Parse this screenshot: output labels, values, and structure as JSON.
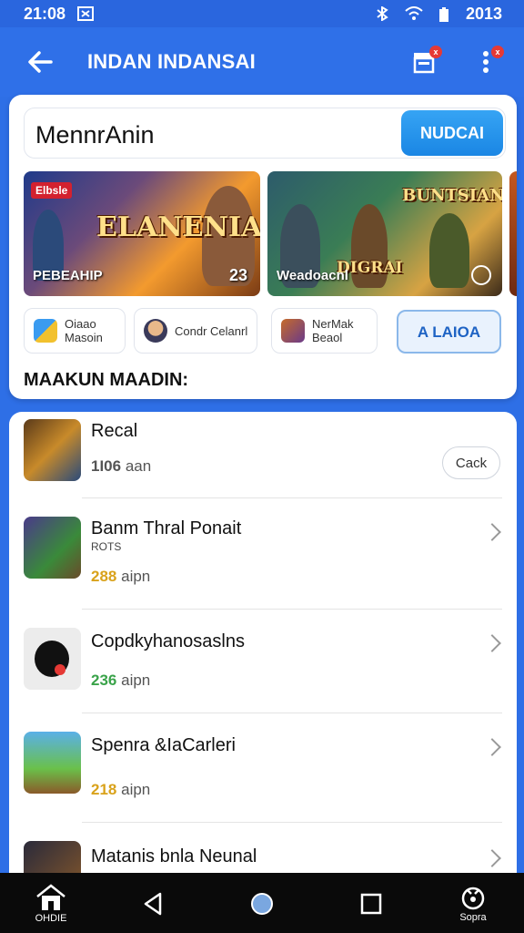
{
  "status_bar": {
    "time": "21:08",
    "right_text": "2013",
    "icons": [
      "notification-icon",
      "bluetooth-icon",
      "wifi-icon",
      "battery-icon"
    ]
  },
  "app_bar": {
    "title": "INDAN INDANSAI",
    "back_icon": "arrow-left-icon",
    "actions": [
      {
        "icon": "store-icon",
        "badge": "x"
      },
      {
        "icon": "more-vert-icon",
        "badge": "x"
      }
    ]
  },
  "search": {
    "value": "MennrAnin",
    "button_label": "NUDCAI"
  },
  "banners": [
    {
      "tag": "Elbsle",
      "logo": "ELANENIAI",
      "caption": "PEBEAHIP",
      "number": "23"
    },
    {
      "logo": "BUNTSIAN",
      "caption": "Weadoacnl",
      "logo2": "DIGRAI"
    }
  ],
  "chips": [
    {
      "label": "Oiaao\nMasoin",
      "icon_color": "#3a9bf0"
    },
    {
      "label": "Condr Celanrl",
      "icon_color": "#8a6b5a"
    },
    {
      "label": "NerMak\nBeaol",
      "icon_color": "#c66b2a"
    },
    {
      "label": "A LAIOA",
      "icon_color": ""
    }
  ],
  "section_title": "MAAKUN MAADIN:",
  "list_items": [
    {
      "title": "Recal",
      "meta_num": "1I06",
      "meta_unit": "aan",
      "action": "Cack",
      "meta_color": "#555555"
    },
    {
      "title": "Banm Thral Ponait",
      "sub": "ROTS",
      "meta_num": "288",
      "meta_unit": "aipn",
      "meta_color": "#d9a21b"
    },
    {
      "title": "Copdkyhanosaslns",
      "meta_num": "236",
      "meta_unit": "aipn",
      "meta_color": "#3aa34a"
    },
    {
      "title": "Spenra &IaCarleri",
      "meta_num": "218",
      "meta_unit": "aipn",
      "meta_color": "#d9a21b"
    },
    {
      "title": "Matanis bnla Neunal"
    }
  ],
  "nav": {
    "home_label": "OHDIE",
    "right_label": "Sopra"
  }
}
